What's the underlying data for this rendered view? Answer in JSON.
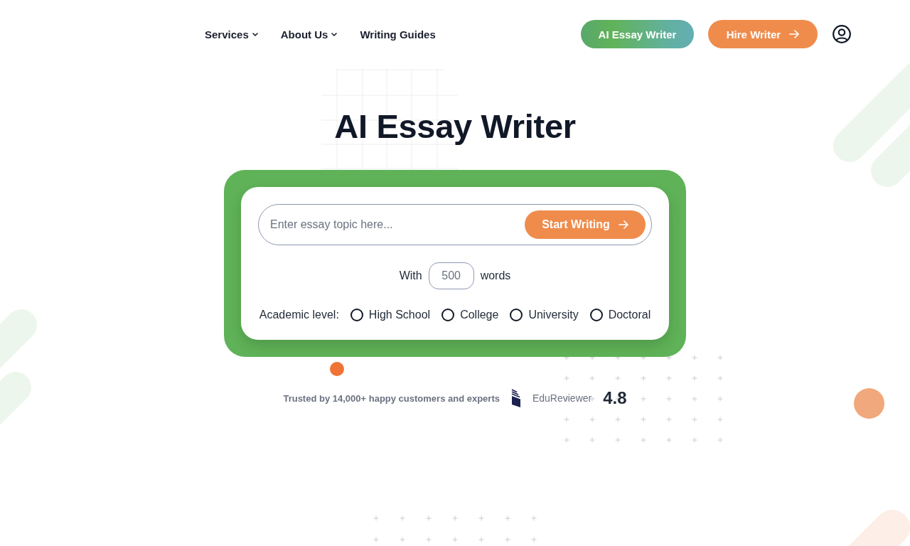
{
  "nav": {
    "links": [
      {
        "label": "Services",
        "dropdown": true
      },
      {
        "label": "About Us",
        "dropdown": true
      },
      {
        "label": "Writing Guides",
        "dropdown": false
      }
    ],
    "buttons": [
      {
        "label": "AI Essay Writer",
        "kind": "highlight"
      },
      {
        "label": "Hire Writer",
        "kind": "primary"
      }
    ]
  },
  "title": "AI Essay Writer",
  "form": {
    "topic": {
      "placeholder": "Enter essay topic here..."
    },
    "submit": "Start Writing",
    "words": {
      "prefix": "With",
      "placeholder": "500",
      "suffix": "words"
    },
    "level": {
      "label": "Academic level:",
      "options": [
        {
          "label": "High School",
          "selected": false
        },
        {
          "label": "College",
          "selected": false
        },
        {
          "label": "University",
          "selected": false
        },
        {
          "label": "Doctoral",
          "selected": false
        }
      ]
    }
  },
  "trust": {
    "text": "Trusted by 14,000+ happy customers and experts",
    "reviewer": "EduReviewer",
    "rating": "4.8"
  }
}
